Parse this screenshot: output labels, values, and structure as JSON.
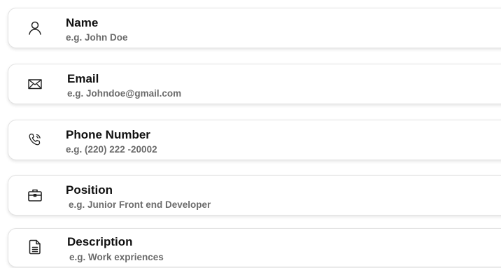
{
  "form": {
    "fields": [
      {
        "label": "Name",
        "placeholder": "e.g. John Doe",
        "icon": "person-icon"
      },
      {
        "label": "Email",
        "placeholder": "e.g. Johndoe@gmail.com",
        "icon": "envelope-icon"
      },
      {
        "label": "Phone Number",
        "placeholder": "e.g. (220) 222 -20002",
        "icon": "phone-icon"
      },
      {
        "label": "Position",
        "placeholder": "e.g. Junior Front end Developer",
        "icon": "briefcase-icon"
      },
      {
        "label": "Description",
        "placeholder": "e.g. Work expriences",
        "icon": "document-icon"
      }
    ]
  },
  "colors": {
    "label": "#111111",
    "placeholder": "#6b6b6b",
    "border": "#e3e3e3",
    "icon": "#222222"
  }
}
